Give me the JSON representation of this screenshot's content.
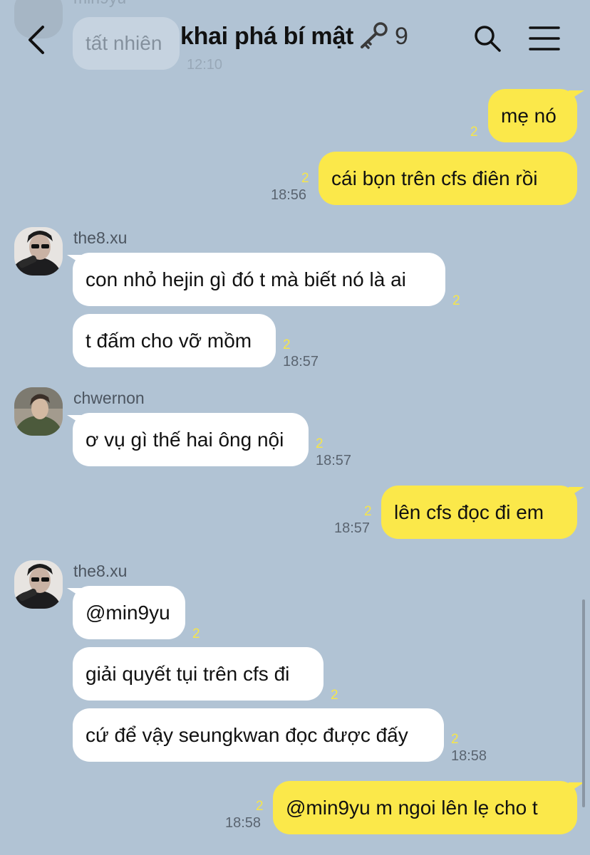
{
  "header": {
    "back_icon": "chevron-left-icon",
    "title": "khai phá bí mật",
    "title_icon": "key-icon",
    "member_count": "9",
    "search_icon": "search-icon",
    "menu_icon": "hamburger-menu-icon"
  },
  "faded_previous": {
    "sender": "min9yu",
    "text": "tất nhiên",
    "time": "12:10"
  },
  "messages": [
    {
      "side": "me",
      "text": "mẹ nó",
      "unread": "2",
      "time": ""
    },
    {
      "side": "me",
      "text": "cái bọn trên cfs điên rồi",
      "unread": "2",
      "time": "18:56"
    },
    {
      "sender": "the8.xu",
      "side": "other",
      "text": "con nhỏ hejin gì đó t mà biết nó là ai",
      "unread": "2",
      "time": ""
    },
    {
      "side": "other",
      "text": "t đấm cho vỡ mồm",
      "unread": "2",
      "time": "18:57"
    },
    {
      "sender": "chwernon",
      "side": "other",
      "text": "ơ vụ gì thế hai ông nội",
      "unread": "2",
      "time": "18:57"
    },
    {
      "side": "me",
      "text": "lên cfs đọc đi em",
      "unread": "2",
      "time": "18:57"
    },
    {
      "sender": "the8.xu",
      "side": "other",
      "text": "@min9yu",
      "unread": "2",
      "time": ""
    },
    {
      "side": "other",
      "text": "giải quyết tụi trên cfs đi",
      "unread": "2",
      "time": ""
    },
    {
      "side": "other",
      "text": "cứ để vậy seungkwan đọc được đấy",
      "unread": "2",
      "time": "18:58"
    },
    {
      "side": "me",
      "text": "@min9yu m ngoi lên lẹ cho t",
      "unread": "2",
      "time": "18:58"
    }
  ],
  "colors": {
    "background": "#b1c3d4",
    "my_bubble": "#fbe84a",
    "other_bubble": "#ffffff",
    "unread": "#f6e54a"
  }
}
